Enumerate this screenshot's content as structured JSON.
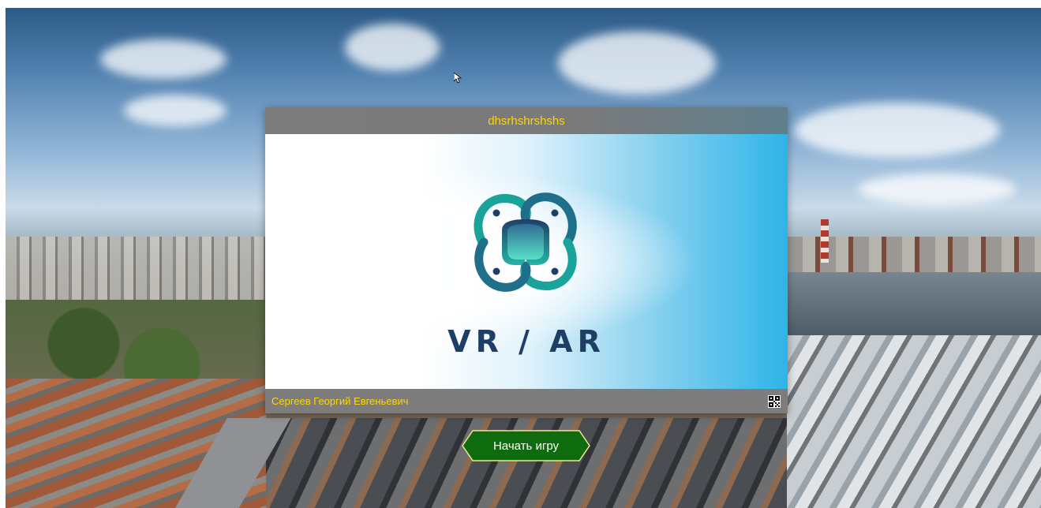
{
  "card": {
    "title": "dhsrhshrshshs",
    "logo_text": "VR / AR",
    "author": "Сергеев Георгий Евгеньевич",
    "qr_icon": "qr-code-icon"
  },
  "actions": {
    "start_label": "Начать игру"
  },
  "colors": {
    "title_text": "#ffd700",
    "header_bg": "#7c7c7c",
    "button_bg": "#0e6b0e",
    "logo_text": "#1f3e66",
    "logo_teal": "#1aa39a"
  }
}
